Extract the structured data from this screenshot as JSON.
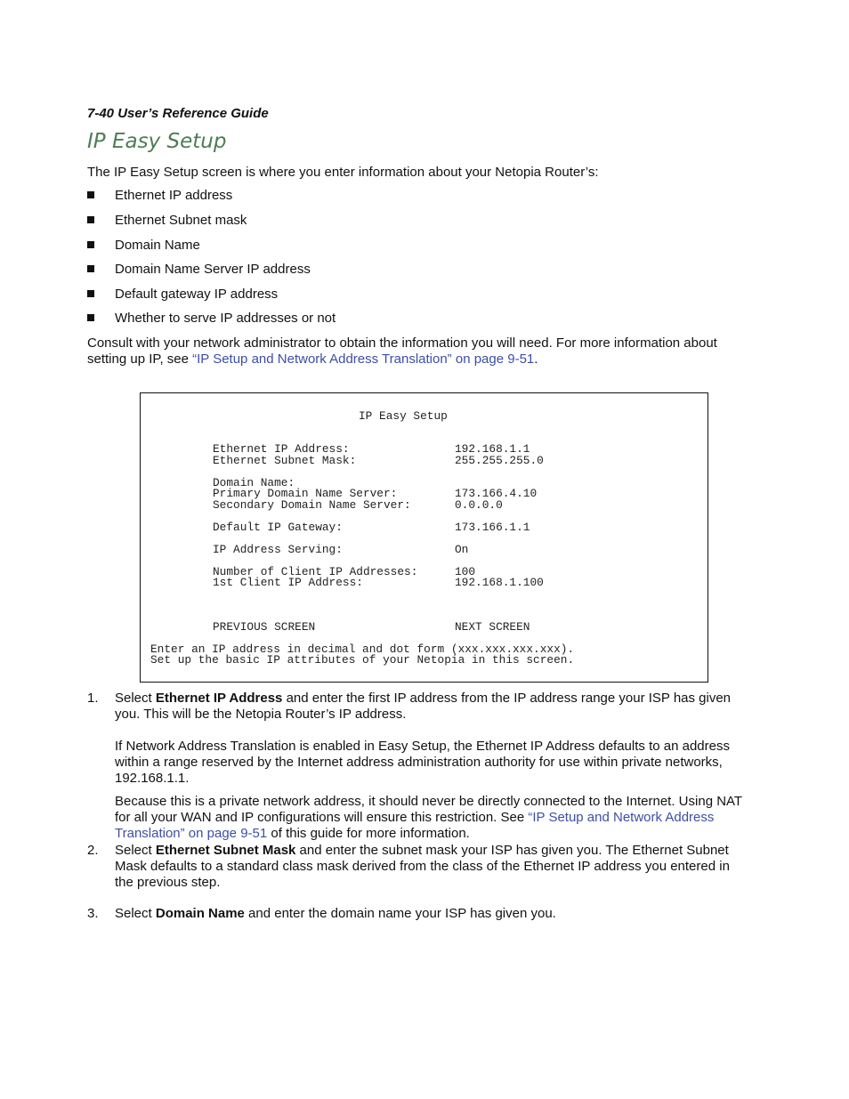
{
  "header": "7-40  User’s Reference Guide",
  "title": "IP Easy Setup",
  "intro": "The IP Easy Setup screen is where you enter information about your Netopia Router’s:",
  "bullets": [
    "Ethernet IP address",
    "Ethernet Subnet mask",
    "Domain Name",
    "Domain Name Server IP address",
    "Default gateway IP address",
    "Whether to serve IP addresses or not"
  ],
  "consult": {
    "line1": "Consult with your network administrator to obtain the information you will need. For more information about",
    "pre": "setting up IP, see ",
    "link": "“IP Setup and Network Address Translation” on page 9-51",
    "post": "."
  },
  "screen": {
    "title": "IP Easy Setup",
    "fields": [
      {
        "label": "Ethernet IP Address:",
        "value": "192.168.1.1"
      },
      {
        "label": "Ethernet Subnet Mask:",
        "value": "255.255.255.0"
      },
      {
        "label": "Domain Name:",
        "value": ""
      },
      {
        "label": "Primary Domain Name Server:",
        "value": "173.166.4.10"
      },
      {
        "label": "Secondary Domain Name Server:",
        "value": "0.0.0.0"
      },
      {
        "label": "Default IP Gateway:",
        "value": "173.166.1.1"
      },
      {
        "label": "IP Address Serving:",
        "value": "On"
      },
      {
        "label": "Number of Client IP Addresses:",
        "value": "100"
      },
      {
        "label": "1st Client IP Address:",
        "value": "192.168.1.100"
      }
    ],
    "previous": "PREVIOUS SCREEN",
    "next": "NEXT SCREEN",
    "help1": "Enter an IP address in decimal and dot form (xxx.xxx.xxx.xxx).",
    "help2": "Set up the basic IP attributes of your Netopia in this screen."
  },
  "steps": [
    {
      "num": "1.",
      "pre": "Select ",
      "bold": "Ethernet IP Address",
      "l1": " and enter the first IP address from the IP address range your ISP has given",
      "l2": "you. This will be the Netopia Router’s IP address."
    },
    {
      "num": "2.",
      "pre": "Select ",
      "bold": "Ethernet Subnet Mask",
      "l1": " and enter the subnet mask your ISP has given you. The Ethernet Subnet",
      "l2": "Mask defaults to a standard class mask derived from the class of the Ethernet IP address you entered in",
      "l3": "the previous step."
    },
    {
      "num": "3.",
      "pre": "Select ",
      "bold": "Domain Name",
      "l1": " and enter the domain name your ISP has given you."
    }
  ],
  "nat": {
    "l1": "If Network Address Translation is enabled in Easy Setup, the Ethernet IP Address defaults to an address",
    "l2": "within a range reserved by the Internet address administration authority for use within private networks,",
    "l3": "192.168.1.1."
  },
  "private": {
    "l1": "Because this is a private network address, it should never be directly connected to the Internet. Using NAT",
    "l2pre": "for all your WAN and IP configurations will ensure this restriction. See ",
    "l2link": "“IP Setup and Network Address",
    "l3link": "Translation” on page 9-51",
    "l3post": " of this guide for more information."
  }
}
